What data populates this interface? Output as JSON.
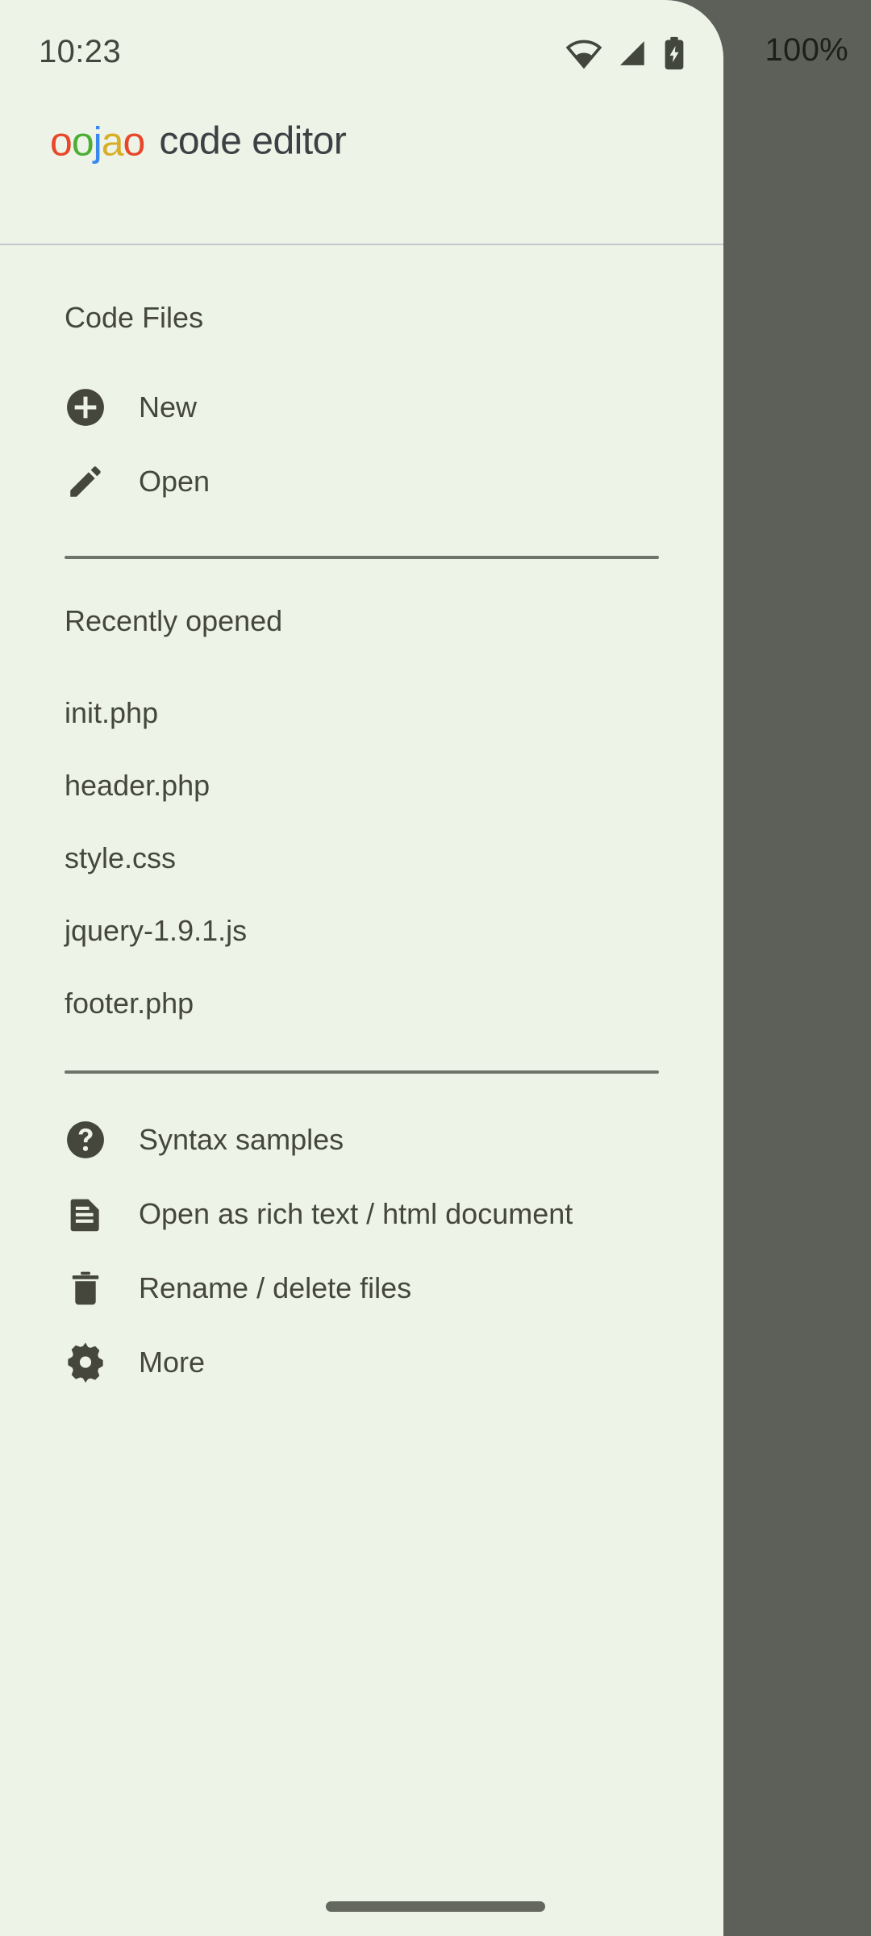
{
  "status_bar": {
    "time": "10:23",
    "battery_percent": "100%",
    "icons": [
      "wifi-icon",
      "cellular-signal-icon",
      "battery-charging-icon"
    ]
  },
  "drawer": {
    "brand": {
      "logo_letters": [
        {
          "char": "o",
          "color": "#E8472A"
        },
        {
          "char": "o",
          "color": "#4CAF34"
        },
        {
          "char": "j",
          "color": "#3B87F0"
        },
        {
          "char": "a",
          "color": "#D9AE26"
        },
        {
          "char": "o",
          "color": "#E8472A"
        }
      ],
      "logo_text": "oojao",
      "title": "code editor"
    },
    "sections": {
      "code_files_title": "Code Files",
      "recently_opened_title": "Recently opened"
    },
    "actions": [
      {
        "icon": "add-circle-icon",
        "label": "New"
      },
      {
        "icon": "pencil-icon",
        "label": "Open"
      }
    ],
    "recent_files": [
      {
        "name": "init.php"
      },
      {
        "name": "header.php"
      },
      {
        "name": "style.css"
      },
      {
        "name": "jquery-1.9.1.js"
      },
      {
        "name": "footer.php"
      }
    ],
    "tools": [
      {
        "icon": "help-circle-icon",
        "label": "Syntax samples"
      },
      {
        "icon": "document-icon",
        "label": "Open as rich text / html document"
      },
      {
        "icon": "trash-icon",
        "label": "Rename / delete files"
      },
      {
        "icon": "gear-icon",
        "label": "More"
      }
    ]
  },
  "colors": {
    "drawer_background": "#EEF3E8",
    "scrim": "#5D5F59",
    "text": "#45473C",
    "title_text": "#3E4144",
    "header_rule": "#C4C8CE",
    "divider": "#70736A",
    "nav_pill": "#64685E"
  },
  "system": {
    "nav_pill": "gesture-nav-pill"
  }
}
